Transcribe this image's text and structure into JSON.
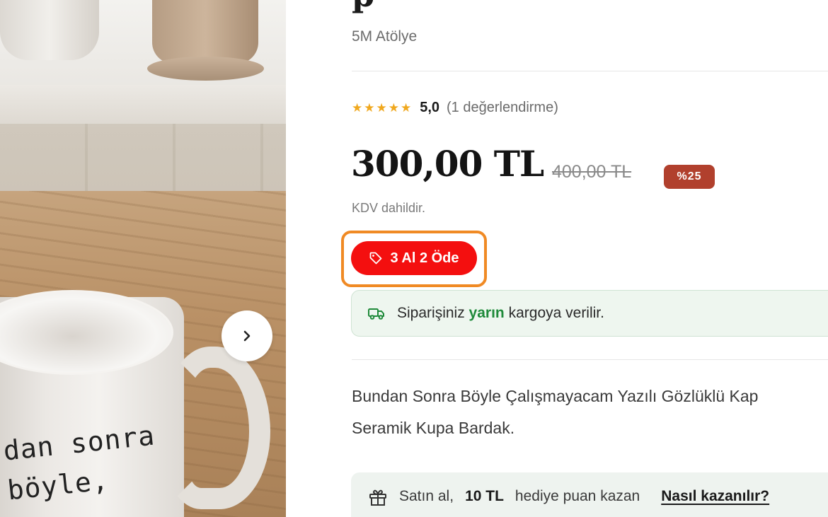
{
  "product": {
    "title_partial": "p",
    "brand": "5M Atölye",
    "rating_value": "5,0",
    "rating_count": "(1 değerlendirme)",
    "stars": "★★★★★",
    "price": "300,00 TL",
    "old_price": "400,00 TL",
    "discount": "%25",
    "vat_note": "KDV dahildir.",
    "description_line1": "Bundan Sonra Böyle Çalışmayacam Yazılı Gözlüklü Kap",
    "description_line2": "Seramik Kupa Bardak."
  },
  "gallery": {
    "mug_text_line1": "dan sonra",
    "mug_text_line2": "böyle,",
    "next_icon": "chevron-right-icon"
  },
  "promo": {
    "label": "3 Al 2 Öde",
    "icon": "tag-icon"
  },
  "shipping": {
    "prefix": "Siparişiniz",
    "highlight": "yarın",
    "suffix": "kargoya verilir.",
    "icon": "truck-icon"
  },
  "points": {
    "prefix": "Satın al,",
    "amount": "10 TL",
    "suffix": "hediye puan kazan",
    "link": "Nasıl kazanılır?",
    "icon": "gift-icon"
  },
  "colors": {
    "promo_red": "#f40f0f",
    "highlight_outline": "#f08a24",
    "discount_badge": "#b1402d",
    "shipping_green": "#1f8a3a",
    "star": "#f0a81e"
  }
}
